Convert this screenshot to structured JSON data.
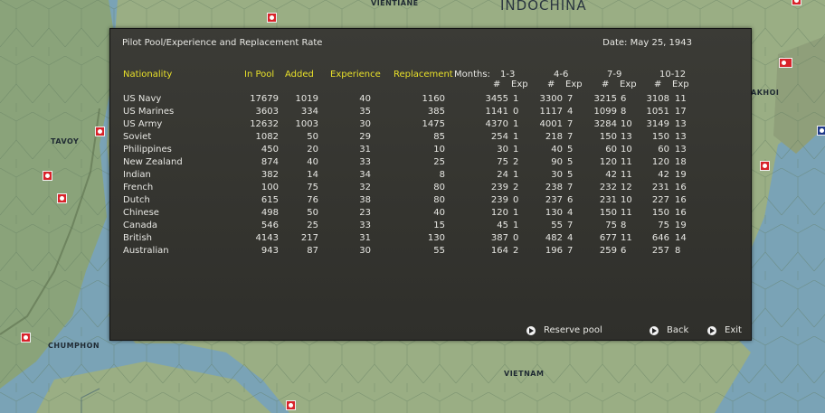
{
  "map": {
    "labels": [
      "VIENTIANE",
      "INDOCHINA",
      "TAVOY",
      "AKHOI",
      "CHUMPHON",
      "VIETNAM"
    ]
  },
  "dialog": {
    "title": "Pilot Pool/Experience and Replacement Rate",
    "date": "Date: May 25, 1943",
    "headers": {
      "nationality": "Nationality",
      "in_pool": "In Pool",
      "added": "Added",
      "experience": "Experience",
      "replacement": "Replacement",
      "months": "Months:",
      "groups": [
        "1-3",
        "4-6",
        "7-9",
        "10-12"
      ],
      "num": "#",
      "exp": "Exp"
    },
    "rows": [
      {
        "name": "US Navy",
        "pool": "17679",
        "added": "1019",
        "exp": "40",
        "repl": "1160",
        "g": [
          [
            "3455",
            "1"
          ],
          [
            "3300",
            "7"
          ],
          [
            "3215",
            "6"
          ],
          [
            "3108",
            "11"
          ]
        ]
      },
      {
        "name": "US Marines",
        "pool": "3603",
        "added": "334",
        "exp": "35",
        "repl": "385",
        "g": [
          [
            "1141",
            "0"
          ],
          [
            "1117",
            "4"
          ],
          [
            "1099",
            "8"
          ],
          [
            "1051",
            "17"
          ]
        ]
      },
      {
        "name": "US Army",
        "pool": "12632",
        "added": "1003",
        "exp": "30",
        "repl": "1475",
        "g": [
          [
            "4370",
            "1"
          ],
          [
            "4001",
            "7"
          ],
          [
            "3284",
            "10"
          ],
          [
            "3149",
            "13"
          ]
        ]
      },
      {
        "name": "Soviet",
        "pool": "1082",
        "added": "50",
        "exp": "29",
        "repl": "85",
        "g": [
          [
            "254",
            "1"
          ],
          [
            "218",
            "7"
          ],
          [
            "150",
            "13"
          ],
          [
            "150",
            "13"
          ]
        ]
      },
      {
        "name": "Philippines",
        "pool": "450",
        "added": "20",
        "exp": "31",
        "repl": "10",
        "g": [
          [
            "30",
            "1"
          ],
          [
            "40",
            "5"
          ],
          [
            "60",
            "10"
          ],
          [
            "60",
            "13"
          ]
        ]
      },
      {
        "name": "New Zealand",
        "pool": "874",
        "added": "40",
        "exp": "33",
        "repl": "25",
        "g": [
          [
            "75",
            "2"
          ],
          [
            "90",
            "5"
          ],
          [
            "120",
            "11"
          ],
          [
            "120",
            "18"
          ]
        ]
      },
      {
        "name": "Indian",
        "pool": "382",
        "added": "14",
        "exp": "34",
        "repl": "8",
        "g": [
          [
            "24",
            "1"
          ],
          [
            "30",
            "5"
          ],
          [
            "42",
            "11"
          ],
          [
            "42",
            "19"
          ]
        ]
      },
      {
        "name": "French",
        "pool": "100",
        "added": "75",
        "exp": "32",
        "repl": "80",
        "g": [
          [
            "239",
            "2"
          ],
          [
            "238",
            "7"
          ],
          [
            "232",
            "12"
          ],
          [
            "231",
            "16"
          ]
        ]
      },
      {
        "name": "Dutch",
        "pool": "615",
        "added": "76",
        "exp": "38",
        "repl": "80",
        "g": [
          [
            "239",
            "0"
          ],
          [
            "237",
            "6"
          ],
          [
            "231",
            "10"
          ],
          [
            "227",
            "16"
          ]
        ]
      },
      {
        "name": "Chinese",
        "pool": "498",
        "added": "50",
        "exp": "23",
        "repl": "40",
        "g": [
          [
            "120",
            "1"
          ],
          [
            "130",
            "4"
          ],
          [
            "150",
            "11"
          ],
          [
            "150",
            "16"
          ]
        ]
      },
      {
        "name": "Canada",
        "pool": "546",
        "added": "25",
        "exp": "33",
        "repl": "15",
        "g": [
          [
            "45",
            "1"
          ],
          [
            "55",
            "7"
          ],
          [
            "75",
            "8"
          ],
          [
            "75",
            "19"
          ]
        ]
      },
      {
        "name": "British",
        "pool": "4143",
        "added": "217",
        "exp": "31",
        "repl": "130",
        "g": [
          [
            "387",
            "0"
          ],
          [
            "482",
            "4"
          ],
          [
            "677",
            "11"
          ],
          [
            "646",
            "14"
          ]
        ]
      },
      {
        "name": "Australian",
        "pool": "943",
        "added": "87",
        "exp": "30",
        "repl": "55",
        "g": [
          [
            "164",
            "2"
          ],
          [
            "196",
            "7"
          ],
          [
            "259",
            "6"
          ],
          [
            "257",
            "8"
          ]
        ]
      }
    ],
    "buttons": {
      "reserve_pool": "Reserve pool",
      "back": "Back",
      "exit": "Exit"
    },
    "colors": {
      "header_yellow": "#e8e02a",
      "panel": "#363632",
      "text": "#e8e8e4"
    }
  }
}
